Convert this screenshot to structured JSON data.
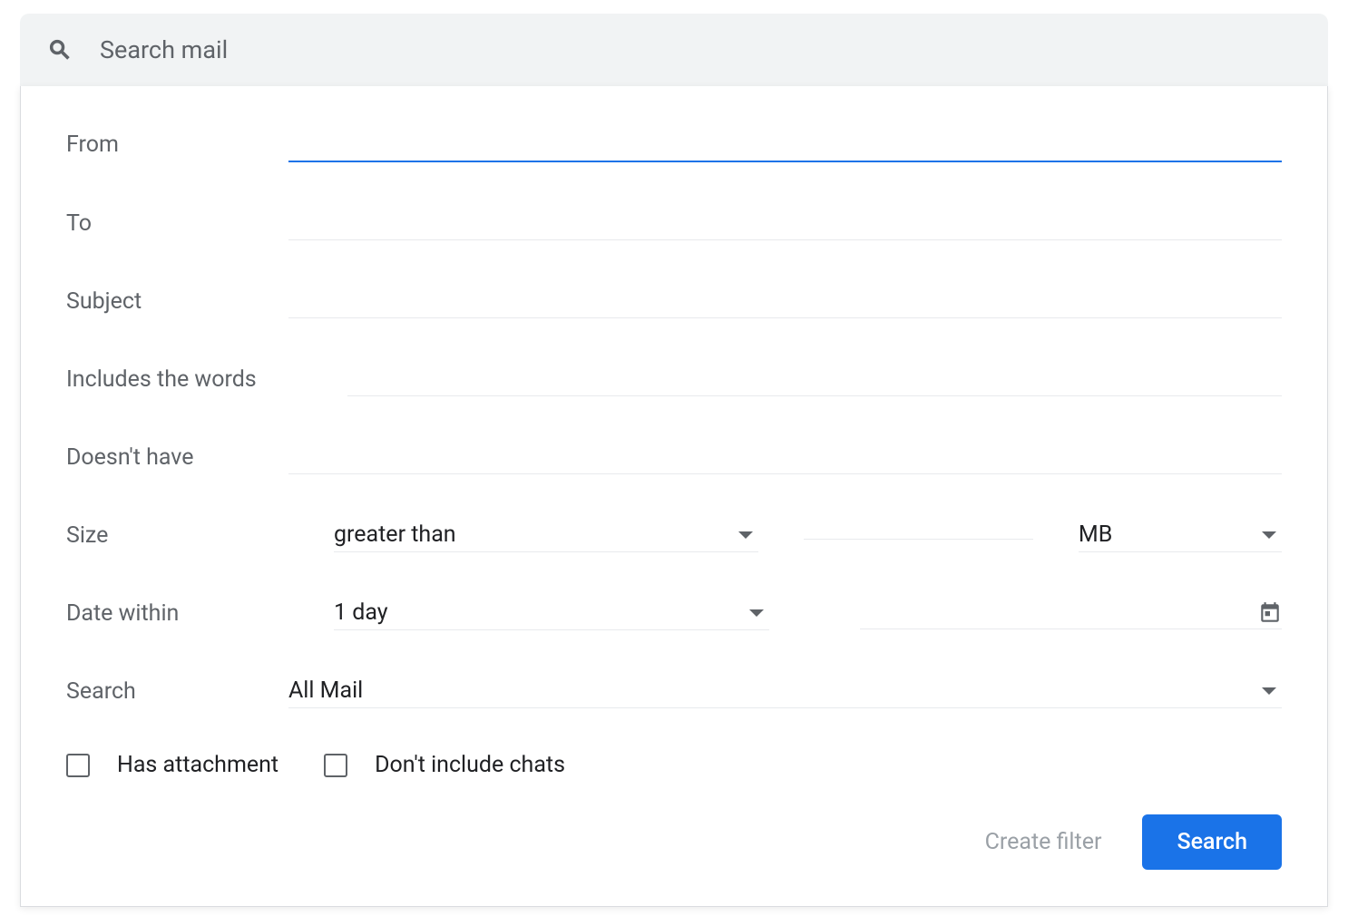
{
  "search": {
    "placeholder": "Search mail"
  },
  "form": {
    "from_label": "From",
    "from_value": "",
    "to_label": "To",
    "to_value": "",
    "subject_label": "Subject",
    "subject_value": "",
    "includes_label": "Includes the words",
    "includes_value": "",
    "excludes_label": "Doesn't have",
    "excludes_value": "",
    "size_label": "Size",
    "size_operator": "greater than",
    "size_value": "",
    "size_unit": "MB",
    "date_label": "Date within",
    "date_range": "1 day",
    "date_value": "",
    "search_label": "Search",
    "search_scope": "All Mail",
    "has_attachment_label": "Has attachment",
    "exclude_chats_label": "Don't include chats"
  },
  "buttons": {
    "create_filter": "Create filter",
    "search": "Search"
  }
}
